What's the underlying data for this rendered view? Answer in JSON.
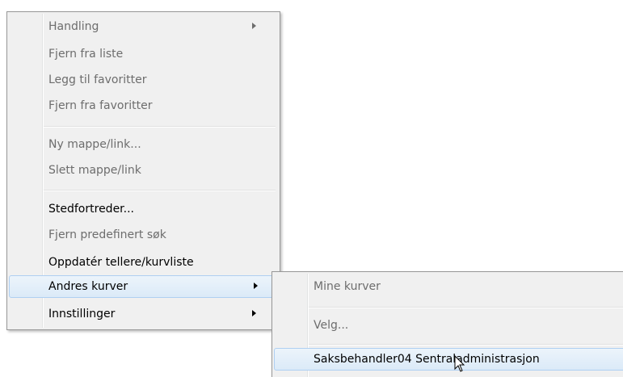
{
  "main_menu": {
    "items": [
      {
        "label": "Handling",
        "disabled": true,
        "submenu": true
      },
      {
        "label": "Fjern fra liste",
        "disabled": true
      },
      {
        "label": "Legg til favoritter",
        "disabled": true
      },
      {
        "label": "Fjern fra favoritter",
        "disabled": true
      },
      {
        "label": "Ny mappe/link...",
        "disabled": true
      },
      {
        "label": "Slett mappe/link",
        "disabled": true
      },
      {
        "label": "Stedfortreder...",
        "disabled": false
      },
      {
        "label": "Fjern predefinert søk",
        "disabled": true
      },
      {
        "label": "Oppdatér tellere/kurvliste",
        "disabled": false
      },
      {
        "label": "Andres kurver",
        "disabled": false,
        "submenu": true,
        "highlighted": true
      },
      {
        "label": "Innstillinger",
        "disabled": false,
        "submenu": true
      }
    ]
  },
  "sub_menu": {
    "items": [
      {
        "label": "Mine kurver",
        "disabled": true
      },
      {
        "label": "Velg...",
        "disabled": true
      },
      {
        "label": "Saksbehandler04 Sentraladministrasjon",
        "disabled": false,
        "highlighted": true
      }
    ]
  },
  "icons": {
    "submenu_arrow": "chevron-right-icon",
    "cursor": "mouse-pointer-icon"
  },
  "colors": {
    "menu_bg": "#f0f0f0",
    "highlight_border": "#aecff2",
    "disabled_text": "#6d6d6d"
  }
}
